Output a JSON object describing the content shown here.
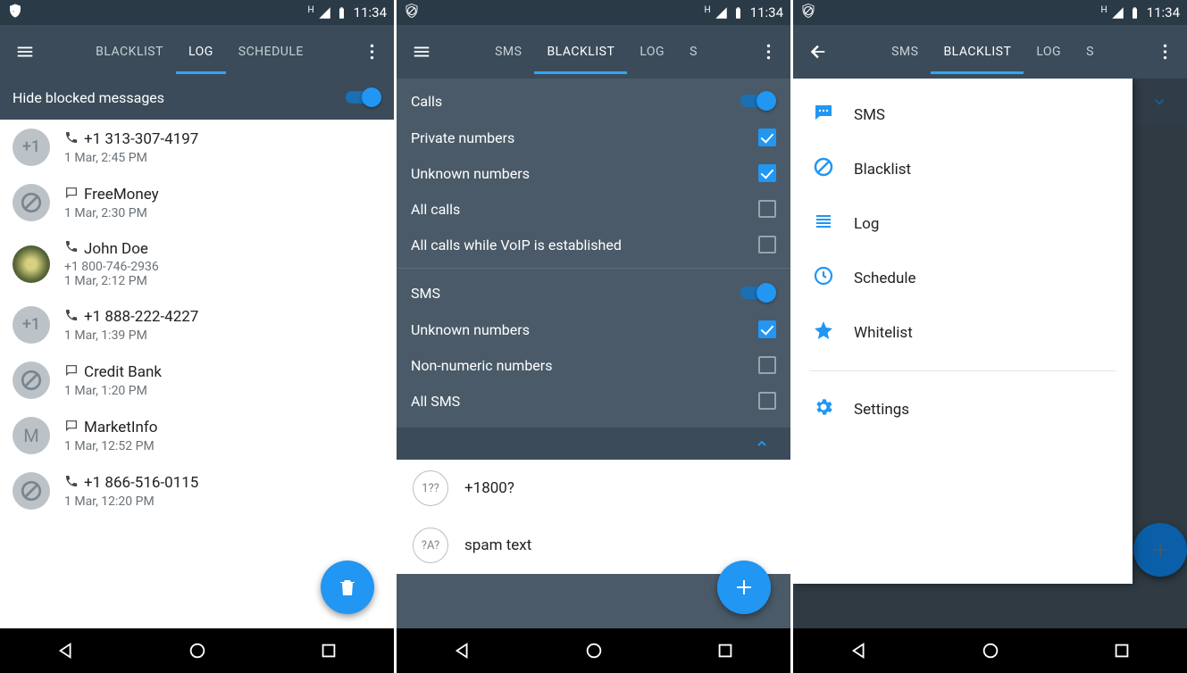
{
  "statusbar": {
    "time": "11:34",
    "net_indicator": "H"
  },
  "shared": {
    "overflow": "⋮"
  },
  "screen1": {
    "tabs": {
      "t0": "BLACKLIST",
      "t1": "LOG",
      "t2": "SCHEDULE"
    },
    "hide_label": "Hide blocked messages",
    "log": [
      {
        "type": "call",
        "title": "+1 313-307-4197",
        "sub": "1 Mar, 2:45 PM",
        "avatar": "plus1"
      },
      {
        "type": "sms",
        "title": "FreeMoney",
        "sub": "1 Mar, 2:30 PM",
        "avatar": "block"
      },
      {
        "type": "call",
        "title": "John Doe",
        "sub": "+1 800-746-2936",
        "sub2": "1 Mar, 2:12 PM",
        "avatar": "photo"
      },
      {
        "type": "call",
        "title": "+1 888-222-4227",
        "sub": "1 Mar, 1:39 PM",
        "avatar": "plus1"
      },
      {
        "type": "sms",
        "title": "Credit Bank",
        "sub": "1 Mar, 1:20 PM",
        "avatar": "block"
      },
      {
        "type": "sms",
        "title": "MarketInfo",
        "sub": "1 Mar, 12:52 PM",
        "avatar": "letter"
      },
      {
        "type": "call",
        "title": "+1 866-516-0115",
        "sub": "1 Mar, 12:20 PM",
        "avatar": "block"
      }
    ]
  },
  "screen2": {
    "tabs": {
      "t0": "SMS",
      "t1": "BLACKLIST",
      "t2": "LOG",
      "t3": "S"
    },
    "sections": {
      "calls": {
        "title": "Calls",
        "toggle": true,
        "rows": [
          {
            "label": "Private numbers",
            "checked": true
          },
          {
            "label": "Unknown numbers",
            "checked": true
          },
          {
            "label": "All calls",
            "checked": false
          },
          {
            "label": "All calls while VoIP is established",
            "checked": false
          }
        ]
      },
      "sms": {
        "title": "SMS",
        "toggle": true,
        "rows": [
          {
            "label": "Unknown numbers",
            "checked": true
          },
          {
            "label": "Non-numeric numbers",
            "checked": false
          },
          {
            "label": "All SMS",
            "checked": false
          }
        ]
      }
    },
    "blacklist_items": [
      {
        "icon": "1??",
        "label": "+1800?"
      },
      {
        "icon": "?A?",
        "label": "spam text"
      }
    ]
  },
  "screen3": {
    "tabs": {
      "t0": "SMS",
      "t1": "BLACKLIST",
      "t2": "LOG",
      "t3": "S"
    },
    "drawer": [
      {
        "icon": "sms-icon",
        "label": "SMS"
      },
      {
        "icon": "block-icon",
        "label": "Blacklist"
      },
      {
        "icon": "log-icon",
        "label": "Log"
      },
      {
        "icon": "clock-icon",
        "label": "Schedule"
      },
      {
        "icon": "star-icon",
        "label": "Whitelist"
      },
      {
        "divider": true
      },
      {
        "icon": "gear-icon",
        "label": "Settings"
      }
    ]
  }
}
